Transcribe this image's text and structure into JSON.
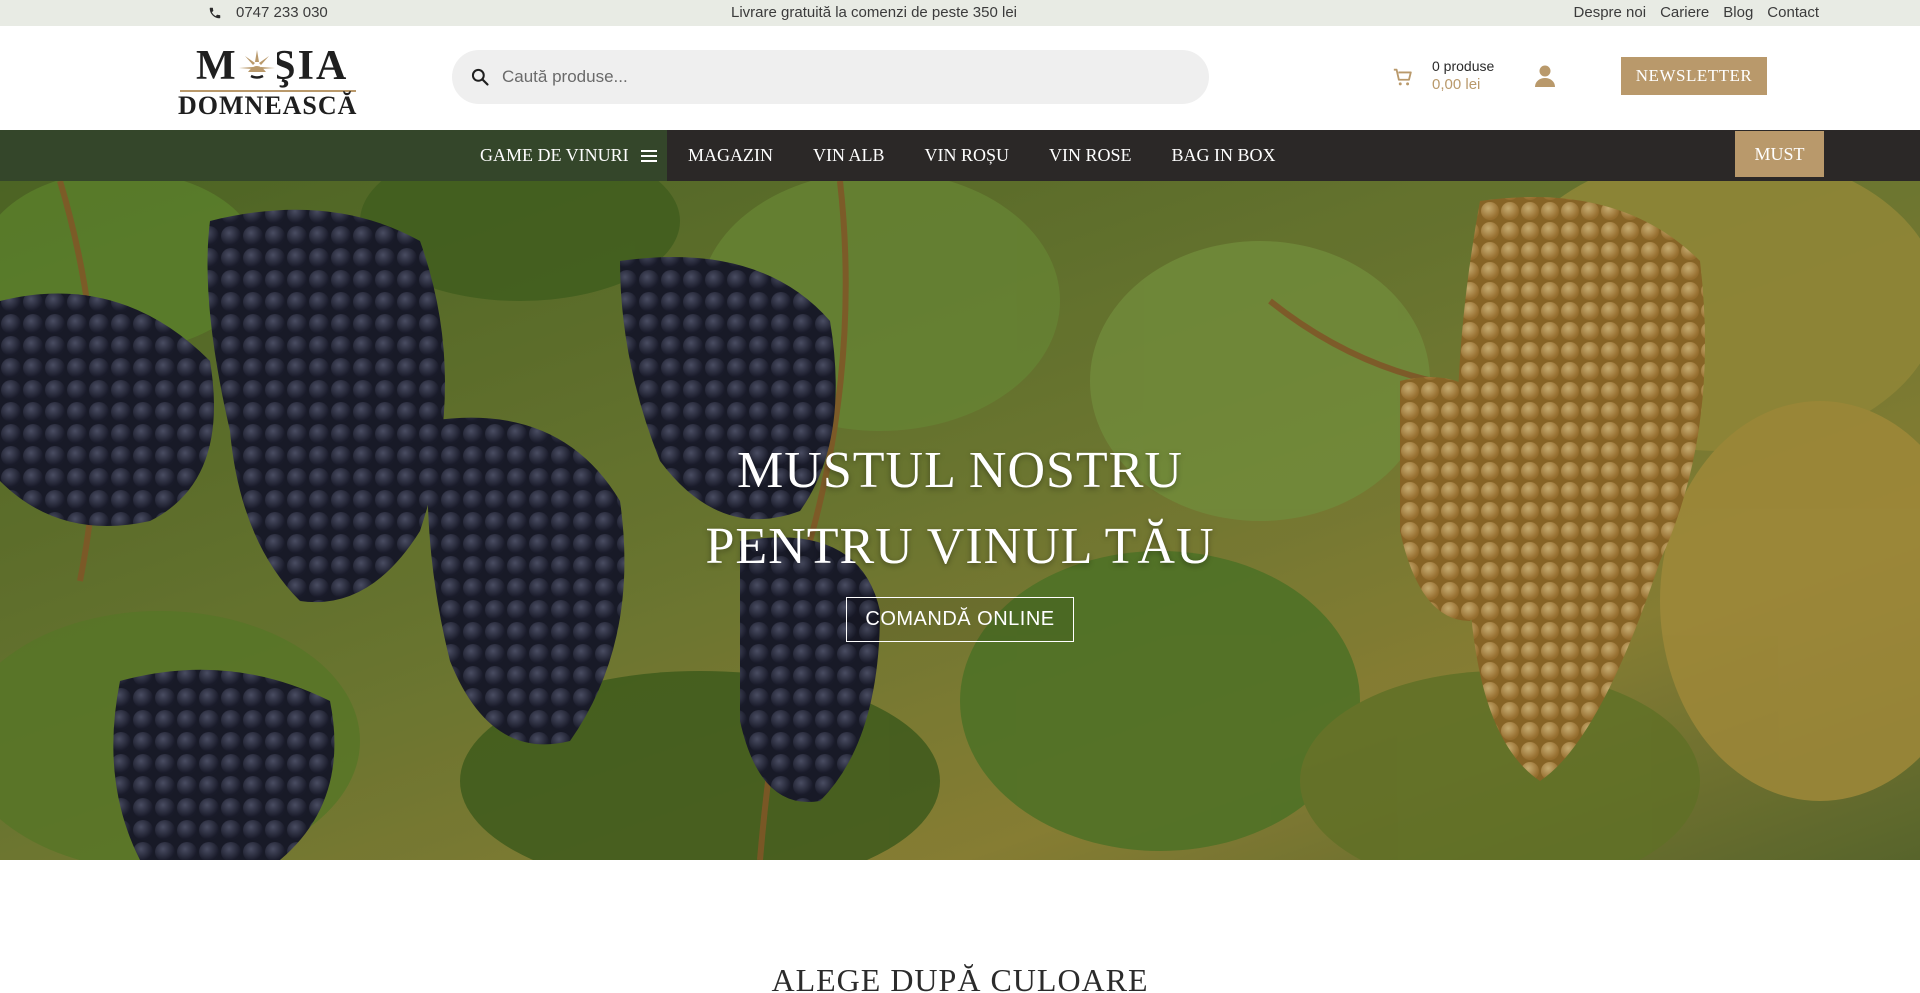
{
  "topbar": {
    "phone": "0747 233 030",
    "promo": "Livrare gratuită la comenzi de peste 350 lei",
    "links": [
      "Despre noi",
      "Cariere",
      "Blog",
      "Contact"
    ]
  },
  "header": {
    "logo": {
      "line1": "MOŞIA",
      "line2": "DOMNEASCĂ"
    },
    "search_placeholder": "Caută produse...",
    "cart": {
      "count": "0 produse",
      "total": "0,00 lei"
    },
    "newsletter_label": "NEWSLETTER"
  },
  "nav": {
    "game_label": "GAME DE VINURI",
    "items": [
      "MAGAZIN",
      "VIN ALB",
      "VIN ROȘU",
      "VIN ROSE",
      "BAG IN BOX"
    ],
    "must_label": "MUST"
  },
  "hero": {
    "title_line1": "MUSTUL NOSTRU",
    "title_line2": "PENTRU VINUL TĂU",
    "cta_label": "COMANDĂ ONLINE"
  },
  "section": {
    "title": "ALEGE DUPĂ CULOARE"
  },
  "colors": {
    "accent": "#b9996b",
    "nav_dark": "#2b2827",
    "nav_green": "#34462a",
    "topbar_bg": "#e8ebe4"
  }
}
